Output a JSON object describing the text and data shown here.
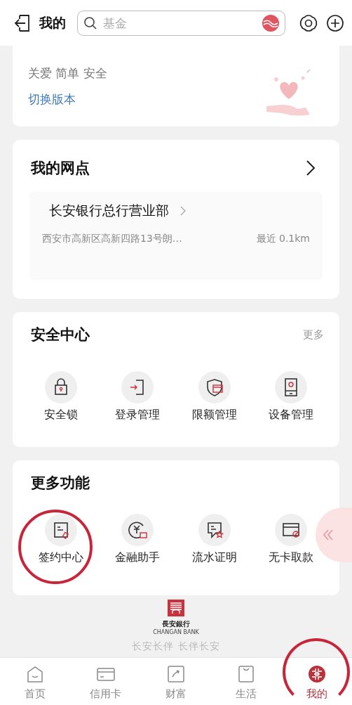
{
  "header": {
    "title": "我的",
    "search": {
      "placeholder": "基金"
    }
  },
  "care_card": {
    "tagline": "关爱 简单 安全",
    "link": "切换版本"
  },
  "branch_card": {
    "title": "我的网点",
    "branch": {
      "name": "长安银行总行营业部",
      "address": "西安市高新区高新四路13号朗…",
      "distance": "最近 0.1km"
    }
  },
  "security_center": {
    "title": "安全中心",
    "more": "更多",
    "items": [
      {
        "label": "安全锁"
      },
      {
        "label": "登录管理"
      },
      {
        "label": "限额管理"
      },
      {
        "label": "设备管理"
      }
    ]
  },
  "more_functions": {
    "title": "更多功能",
    "items": [
      {
        "label": "签约中心"
      },
      {
        "label": "金融助手"
      },
      {
        "label": "流水证明"
      },
      {
        "label": "无卡取款"
      }
    ]
  },
  "footer": {
    "logo_name": "長安銀行",
    "logo_english": "CHANGAN BANK",
    "slogan": "长安长伴 长伴长安"
  },
  "tab_bar": [
    {
      "label": "首页",
      "selected": false
    },
    {
      "label": "信用卡",
      "selected": false
    },
    {
      "label": "财富",
      "selected": false
    },
    {
      "label": "生活",
      "selected": false
    },
    {
      "label": "我的",
      "selected": true
    }
  ]
}
